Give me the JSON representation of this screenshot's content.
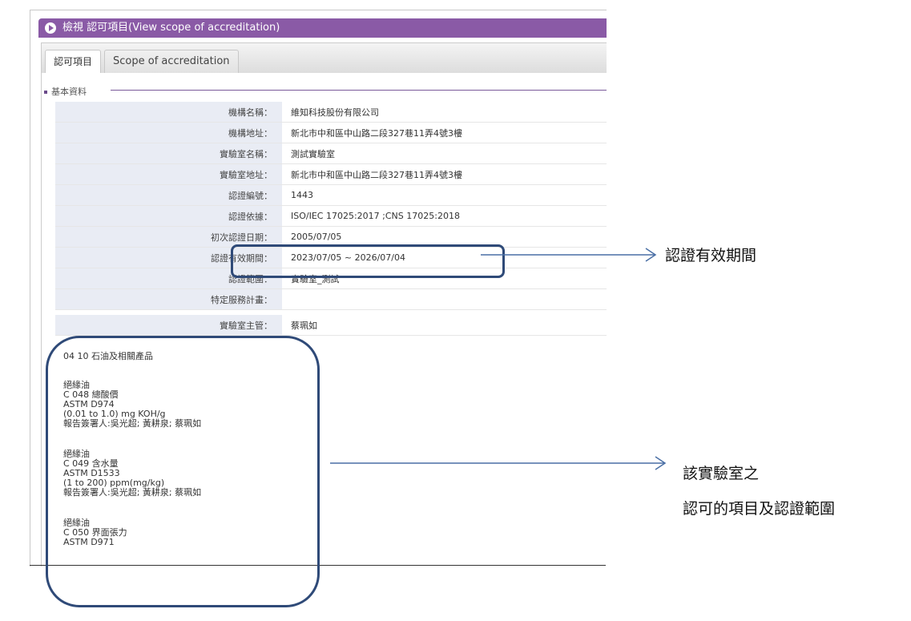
{
  "window": {
    "title": "檢視 認可項目(View scope of accreditation)"
  },
  "tabs": [
    {
      "label": "認可項目"
    },
    {
      "label": "Scope of accreditation"
    }
  ],
  "section": {
    "title": "基本資料"
  },
  "info": {
    "rows": [
      {
        "label": "機構名稱：",
        "value": "維知科技股份有限公司"
      },
      {
        "label": "機構地址：",
        "value": "新北市中和區中山路二段327巷11弄4號3樓"
      },
      {
        "label": "實驗室名稱：",
        "value": "測試實驗室"
      },
      {
        "label": "實驗室地址：",
        "value": "新北市中和區中山路二段327巷11弄4號3樓"
      },
      {
        "label": "認證編號：",
        "value": "1443"
      },
      {
        "label": "認證依據：",
        "value": "ISO/IEC 17025:2017 ;CNS 17025:2018"
      },
      {
        "label": "初次認證日期：",
        "value": "2005/07/05"
      },
      {
        "label": "認證有效期間：",
        "value": "2023/07/05 ~ 2026/07/04"
      },
      {
        "label": "認證範圍：",
        "value": "實驗室_測試"
      },
      {
        "label": "特定服務計畫：",
        "value": ""
      },
      {
        "label": "實驗室主管：",
        "value": "蔡珮如"
      }
    ]
  },
  "scope": {
    "heading": "04 10 石油及相關產品",
    "items": [
      {
        "lines": [
          "絕緣油",
          "C 048 總酸價",
          "ASTM D974",
          "(0.01 to 1.0) mg KOH/g",
          "報告簽署人:吳光超; 黃耕泉; 蔡珮如"
        ]
      },
      {
        "lines": [
          "絕緣油",
          "C 049 含水量",
          "ASTM D1533",
          "(1 to 200) ppm(mg/kg)",
          "報告簽署人:吳光超; 黃耕泉; 蔡珮如"
        ]
      },
      {
        "lines": [
          "絕緣油",
          "C 050 界面張力",
          "ASTM D971"
        ]
      }
    ]
  },
  "annotations": {
    "validity": "認證有效期間",
    "scope_line1": "該實驗室之",
    "scope_line2": "認可的項目及認證範圍"
  },
  "colors": {
    "titlebar": "#8a5aa6",
    "label_bg": "#e9ecf4",
    "highlight_box": "#2f4a78",
    "arrow": "#4a6fa5"
  },
  "icons": {
    "title": "play-circle-icon"
  }
}
